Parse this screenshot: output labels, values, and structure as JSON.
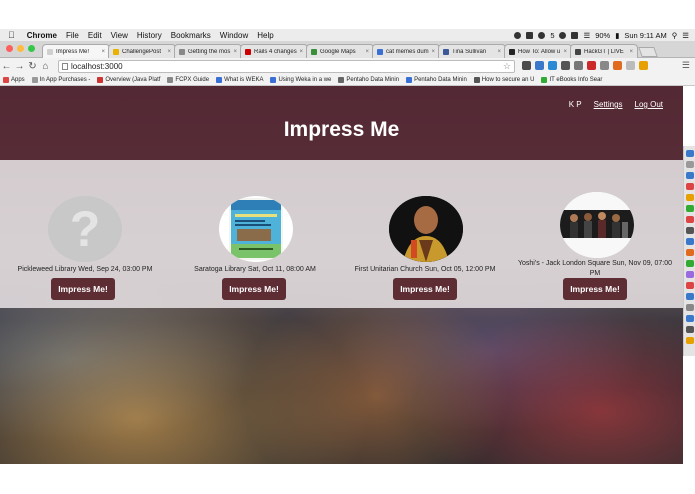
{
  "menubar": {
    "app": "Chrome",
    "items": [
      "File",
      "Edit",
      "View",
      "History",
      "Bookmarks",
      "Window",
      "Help"
    ],
    "battery": "90%",
    "clock": "Sun 9:11 AM",
    "badge_count": "5"
  },
  "tabs": [
    {
      "title": "Impress Me!",
      "color": "#d0d0d0"
    },
    {
      "title": "ChallengePost",
      "color": "#e9b200"
    },
    {
      "title": "Getting the mos",
      "color": "#888888"
    },
    {
      "title": "Rails 4 changes",
      "color": "#cc0000"
    },
    {
      "title": "Google Maps",
      "color": "#3a8f3a"
    },
    {
      "title": "cat memes dumb",
      "color": "#3a6fd6"
    },
    {
      "title": "Tina Sullivan",
      "color": "#3b5998"
    },
    {
      "title": "How To: Allow u",
      "color": "#222222"
    },
    {
      "title": "HackGT | LIVE",
      "color": "#444444"
    }
  ],
  "address_bar": {
    "url": "localhost:3000"
  },
  "bookmarks": [
    {
      "label": "Apps",
      "color": "#d44"
    },
    {
      "label": "In App Purchases -",
      "color": "#999"
    },
    {
      "label": "Overview (Java Platf",
      "color": "#c33"
    },
    {
      "label": "FCPX Guide",
      "color": "#888"
    },
    {
      "label": "What is WEKA",
      "color": "#3a6fd6"
    },
    {
      "label": "Using Weka in a we",
      "color": "#3a6fd6"
    },
    {
      "label": "Pentaho Data Minin",
      "color": "#666"
    },
    {
      "label": "Pentaho Data Minin",
      "color": "#3a6fd6"
    },
    {
      "label": "How to secure an U",
      "color": "#555"
    },
    {
      "label": "IT eBooks Info Sear",
      "color": "#3a3"
    }
  ],
  "site": {
    "title": "Impress Me",
    "user_initials": "K P",
    "settings_label": "Settings",
    "logout_label": "Log Out"
  },
  "events": [
    {
      "label": "Pickleweed Library Wed, Sep 24, 03:00 PM",
      "button": "Impress Me!"
    },
    {
      "label": "Saratoga Library Sat, Oct 11, 08:00 AM",
      "button": "Impress Me!"
    },
    {
      "label": "First Unitarian Church Sun, Oct 05, 12:00 PM",
      "button": "Impress Me!"
    },
    {
      "label": "Yoshi's - Jack London Square Sun, Nov 09, 07:00 PM",
      "button": "Impress Me!"
    }
  ],
  "colors": {
    "header_bg": "#5e2d34",
    "button_bg": "#5e2d34",
    "events_band": "#e1dcde"
  }
}
